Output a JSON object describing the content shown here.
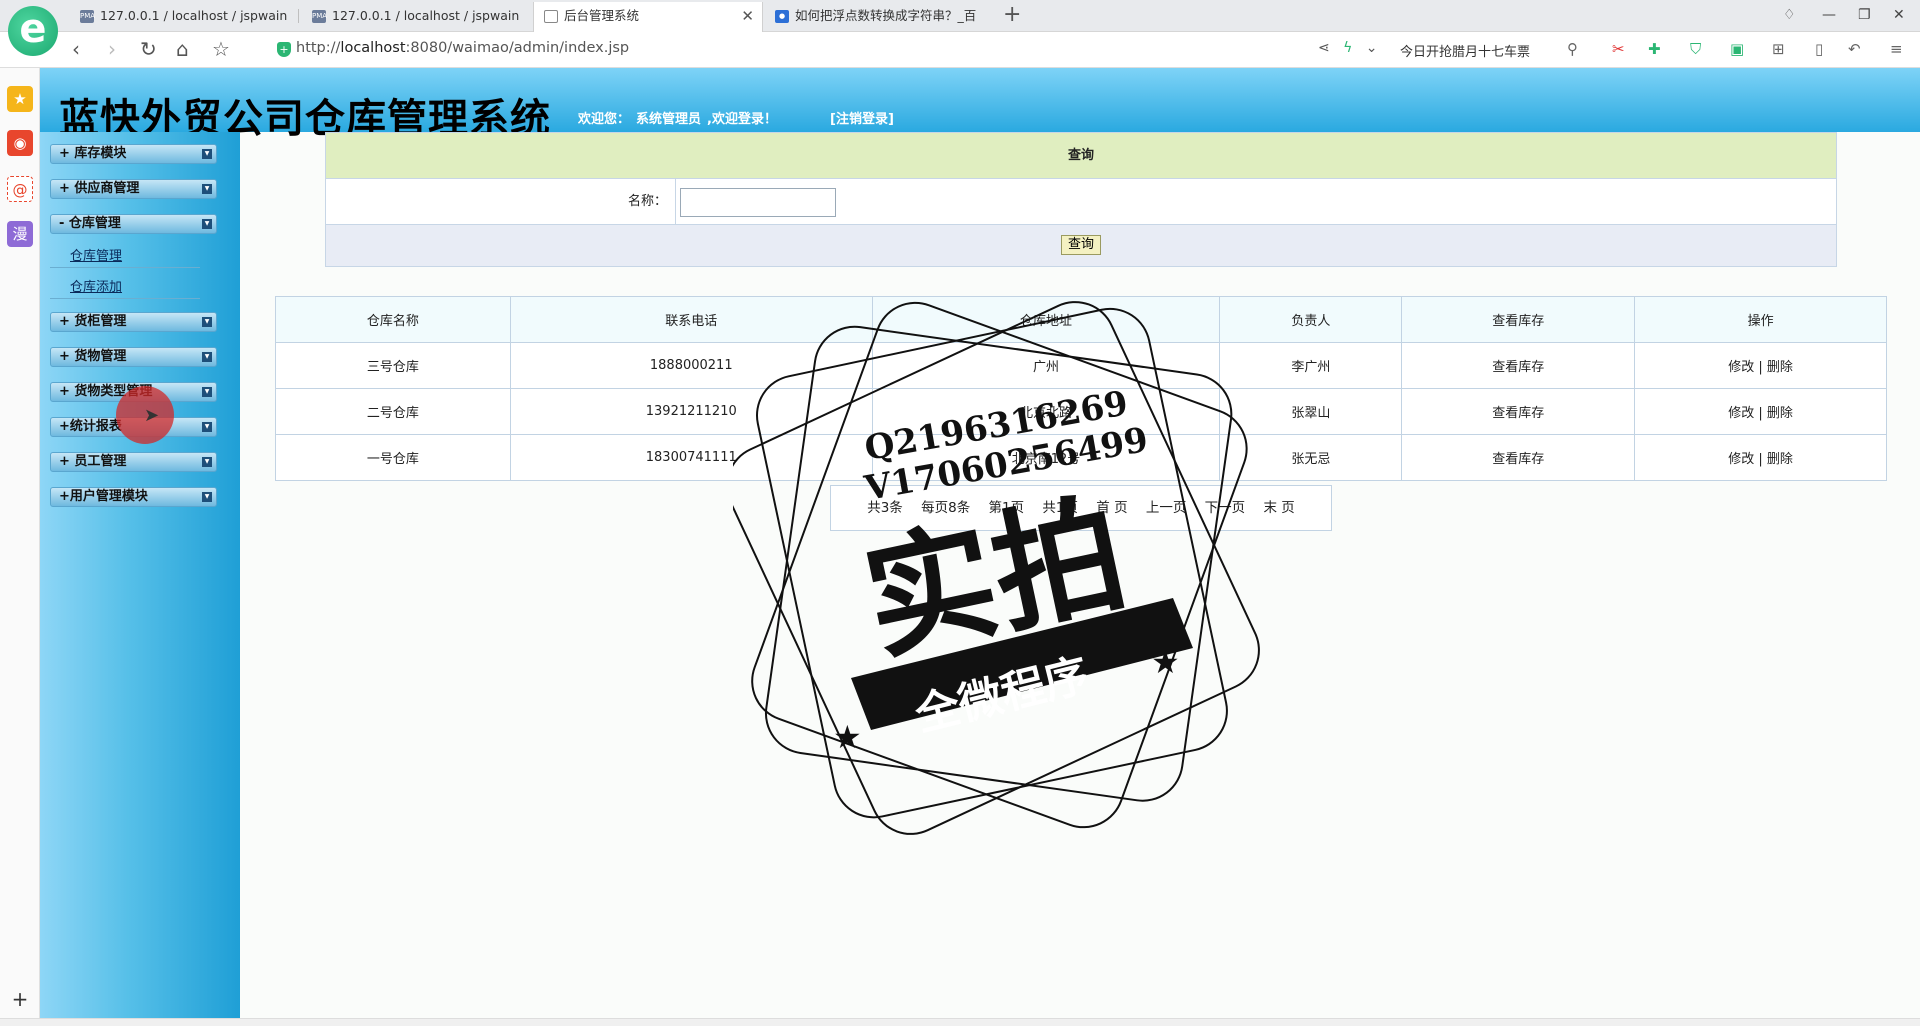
{
  "browser": {
    "tabs": [
      {
        "label": "127.0.0.1 / localhost / jspwain",
        "favicon": "PMA"
      },
      {
        "label": "127.0.0.1 / localhost / jspwain",
        "favicon": "PMA"
      },
      {
        "label": "后台管理系统"
      },
      {
        "label": "如何把浮点数转换成字符串？_百"
      }
    ],
    "url_prefix": "http://",
    "url_host": "localhost",
    "url_rest": ":8080/waimao/admin/index.jsp",
    "hot_news": "今日开抢腊月十七车票"
  },
  "header": {
    "title": "蓝快外贸公司仓库管理系统",
    "welcome_prefix": "欢迎您：",
    "user": "系统管理员",
    "welcome_suffix": ",欢迎登录！",
    "logout": "[注销登录]"
  },
  "sidebar": {
    "menus": [
      {
        "label": "+ 库存模块"
      },
      {
        "label": "+ 供应商管理"
      },
      {
        "label": "- 仓库管理",
        "children": [
          "仓库管理",
          "仓库添加"
        ]
      },
      {
        "label": "+ 货柜管理"
      },
      {
        "label": "+ 货物管理"
      },
      {
        "label": "+ 货物类型管理"
      },
      {
        "label": "+统计报表"
      },
      {
        "label": "+ 员工管理"
      },
      {
        "label": "+用户管理模块"
      }
    ]
  },
  "search": {
    "heading": "查询",
    "name_label": "名称：",
    "name_value": "",
    "button": "查询"
  },
  "table": {
    "columns": [
      "仓库名称",
      "联系电话",
      "仓库地址",
      "负责人",
      "查看库存",
      "操作"
    ],
    "rows": [
      {
        "name": "三号仓库",
        "phone": "1888000211",
        "address": "广州",
        "manager": "李广州",
        "stock": "查看库存",
        "edit": "修改",
        "sep": "|",
        "del": "删除"
      },
      {
        "name": "二号仓库",
        "phone": "13921211210",
        "address": "北京北路",
        "manager": "张翠山",
        "stock": "查看库存",
        "edit": "修改",
        "sep": "|",
        "del": "删除"
      },
      {
        "name": "一号仓库",
        "phone": "18300741111",
        "address": "北京南12号",
        "manager": "张无忌",
        "stock": "查看库存",
        "edit": "修改",
        "sep": "|",
        "del": "删除"
      }
    ]
  },
  "pager": {
    "total": "共3条",
    "per_page": "每页8条",
    "current": "第1页",
    "pages": "共1页",
    "first": "首 页",
    "prev": "上一页",
    "next": "下一页",
    "last": "末 页"
  },
  "watermark": {
    "line1": "Q2196316269",
    "line2": "V17060256499",
    "big": "实拍",
    "banner": "全微程序"
  }
}
